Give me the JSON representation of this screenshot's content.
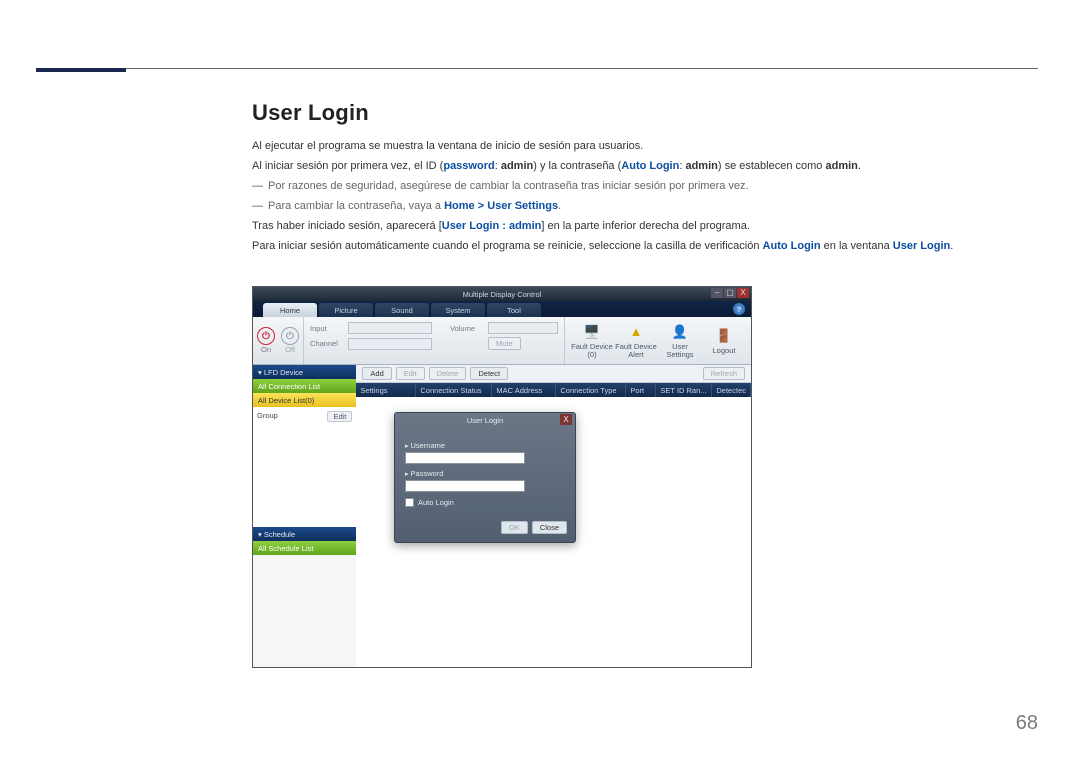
{
  "page_number": "68",
  "heading": "User Login",
  "paragraphs": {
    "p1": "Al ejecutar el programa se muestra la ventana de inicio de sesión para usuarios.",
    "p2_a": "Al iniciar sesión por primera vez, el ID (",
    "p2_pw": "password",
    "p2_b": ": ",
    "p2_admin1": "admin",
    "p2_c": ") y la contraseña (",
    "p2_al": "Auto Login",
    "p2_d": ": ",
    "p2_admin2": "admin",
    "p2_e": ") se establecen como ",
    "p2_admin3": "admin",
    "p2_f": ".",
    "note1": "Por razones de seguridad, asegúrese de cambiar la contraseña tras iniciar sesión por primera vez.",
    "note2_a": "Para cambiar la contraseña, vaya a ",
    "note2_home": "Home",
    "note2_gt": " > ",
    "note2_us": "User Settings",
    "note2_b": ".",
    "p3_a": "Tras haber iniciado sesión, aparecerá [",
    "p3_ul": "User Login : admin",
    "p3_b": "] en la parte inferior derecha del programa.",
    "p4_a": "Para iniciar sesión automáticamente cuando el programa se reinicie, seleccione la casilla de verificación ",
    "p4_al": "Auto Login",
    "p4_b": " en la ventana ",
    "p4_ul": "User Login",
    "p4_c": "."
  },
  "app": {
    "title": "Multiple Display Control",
    "tabs": {
      "home": "Home",
      "picture": "Picture",
      "sound": "Sound",
      "system": "System",
      "tool": "Tool"
    },
    "help": "?",
    "ribbon": {
      "power_on": "On",
      "power_off": "Off",
      "input_label": "Input",
      "channel_label": "Channel",
      "volume_label": "Volume",
      "mute": "Mute",
      "fault_device": "Fault Device (0)",
      "fault_alert": "Fault Device Alert",
      "user_settings": "User Settings",
      "logout": "Logout"
    },
    "sidebar": {
      "lfd_device": "▾ LFD Device",
      "all_conn": "All Connection List",
      "all_dev": "All Device List(0)",
      "group": "Group",
      "edit": "Edit",
      "schedule": "▾ Schedule",
      "all_sched": "All Schedule List"
    },
    "toolbar": {
      "add": "Add",
      "edit": "Edit",
      "delete": "Delete",
      "detect": "Detect",
      "refresh": "Refresh"
    },
    "columns": {
      "settings": "Settings",
      "conn": "Connection Status",
      "mac": "MAC Address",
      "type": "Connection Type",
      "port": "Port",
      "setid": "SET ID Ran...",
      "detected": "Detectec"
    },
    "dialog": {
      "title": "User Login",
      "username": "Username",
      "password": "Password",
      "auto": "Auto Login",
      "ok": "OK",
      "close": "Close"
    }
  }
}
